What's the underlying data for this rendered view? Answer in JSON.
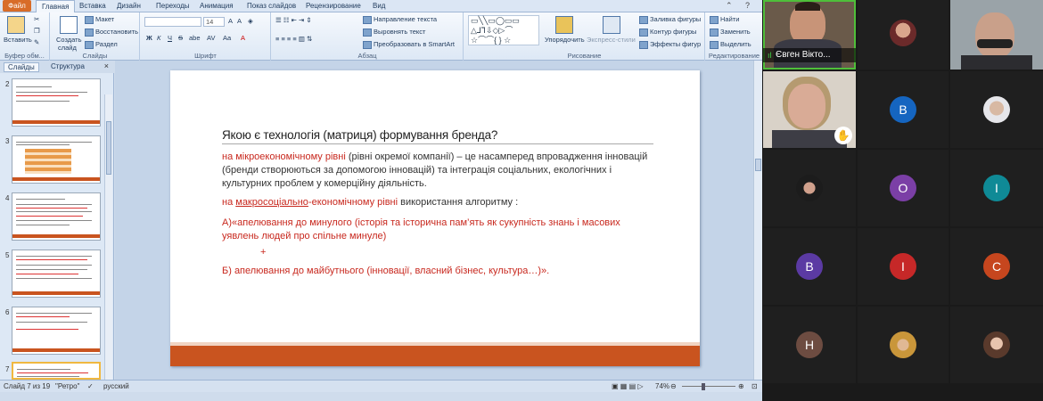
{
  "ribbon": {
    "file_tab": "Файл",
    "tabs": [
      "Главная",
      "Вставка",
      "Дизайн",
      "Переходы",
      "Анимация",
      "Показ слайдов",
      "Рецензирование",
      "Вид"
    ],
    "clipboard": {
      "paste": "Вставить",
      "label": "Буфер обм..."
    },
    "slides": {
      "new_slide": "Создать",
      "new_slide2": "слайд",
      "layout": "Макет",
      "reset": "Восстановить",
      "section": "Раздел",
      "label": "Слайды"
    },
    "font": {
      "size": "14",
      "label": "Шрифт",
      "bold": "Ж",
      "italic": "К",
      "underline": "Ч",
      "strike": "S",
      "shadow": "abe",
      "spacing": "AV",
      "case": "Aa",
      "grow": "A",
      "shrink": "A"
    },
    "paragraph": {
      "direction": "Направление текста",
      "align_text": "Выровнять текст",
      "smartart": "Преобразовать в SmartArt",
      "label": "Абзац"
    },
    "drawing": {
      "arrange": "Упорядочить",
      "quick": "Экспресс-стили",
      "fill": "Заливка фигуры",
      "outline": "Контур фигуры",
      "effects": "Эффекты фигур",
      "label": "Рисование"
    },
    "editing": {
      "find": "Найти",
      "replace": "Заменить",
      "select": "Выделить",
      "label": "Редактирование"
    }
  },
  "leftpane": {
    "tab_slides": "Слайды",
    "tab_outline": "Структура",
    "close": "×",
    "thumb_numbers": [
      "2",
      "3",
      "4",
      "5",
      "6",
      "7"
    ]
  },
  "slide": {
    "title": "Якою є технологія (матриця) формування бренда?",
    "p1_red": "на мікроекономічному рівні",
    "p1_rest": " (рівні окремої компанії) – це насамперед впровадження інновацій (бренди створюються за допомогою інновацій) та інтеграція соціальних, екологічних і культурних проблем у комерційну діяльність.",
    "p2_red_a": "на ",
    "p2_red_u": "макросоціально",
    "p2_red_b": "-економічному рівні",
    "p2_rest": " використання алгоритму :",
    "p3": "А)«апелювання до минулого (історія та історична пам’ять як сукупність знань і масових уявлень людей про спільне минуле)",
    "plus": "+",
    "p4": "Б) апелювання до майбутнього (інновації, власний бізнес, культура…)»."
  },
  "status": {
    "slide_of": "Слайд 7 из 19",
    "theme": "\"Ретро\"",
    "language": "русский",
    "zoom": "74%"
  },
  "meeting": {
    "active_speaker_name": "Євген Вікто...",
    "participants": [
      {
        "initial": "B",
        "color": "#1565c0"
      },
      {
        "initial": "O",
        "color": "#7b3fa6"
      },
      {
        "initial": "I",
        "color": "#0f8a96"
      },
      {
        "initial": "B",
        "color": "#5b3aa3"
      },
      {
        "initial": "I",
        "color": "#c62828"
      },
      {
        "initial": "C",
        "color": "#c6461e"
      },
      {
        "initial": "H",
        "color": "#6d4c41"
      }
    ]
  },
  "colors": {
    "accent": "#c9541f",
    "red_text": "#c8281e"
  }
}
